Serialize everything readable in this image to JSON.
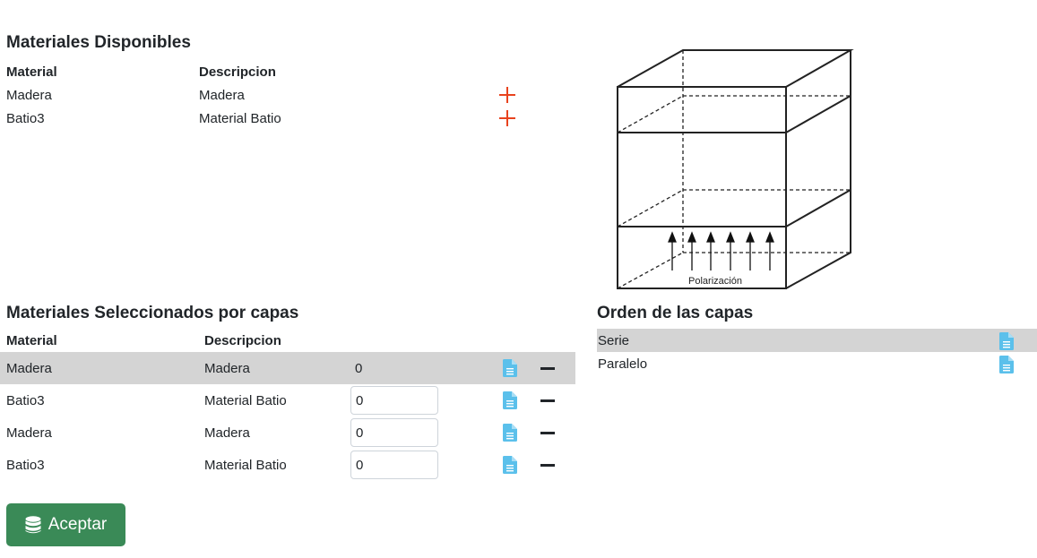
{
  "available": {
    "title": "Materiales Disponibles",
    "headers": {
      "material": "Material",
      "description": "Descripcion"
    },
    "rows": [
      {
        "material": "Madera",
        "description": "Madera",
        "action_icon": "plus-icon"
      },
      {
        "material": "Batio3",
        "description": "Material Batio",
        "action_icon": "plus-icon"
      }
    ]
  },
  "diagram": {
    "label": "Polarización"
  },
  "selected": {
    "title": "Materiales Seleccionados por capas",
    "headers": {
      "material": "Material",
      "description": "Descripcion"
    },
    "rows": [
      {
        "material": "Madera",
        "description": "Madera",
        "value": "0"
      },
      {
        "material": "Batio3",
        "description": "Material Batio",
        "value": "0"
      },
      {
        "material": "Madera",
        "description": "Madera",
        "value": "0"
      },
      {
        "material": "Batio3",
        "description": "Material Batio",
        "value": "0"
      }
    ]
  },
  "order": {
    "title": "Orden de las capas",
    "items": [
      {
        "label": "Serie"
      },
      {
        "label": "Paralelo"
      }
    ]
  },
  "accept_button": {
    "label": "Aceptar",
    "icon": "database-icon"
  },
  "colors": {
    "plus": "#e8431e",
    "doc_icon": "#5bc0eb",
    "button": "#3a8a57",
    "selected_row": "#d4d4d4"
  }
}
